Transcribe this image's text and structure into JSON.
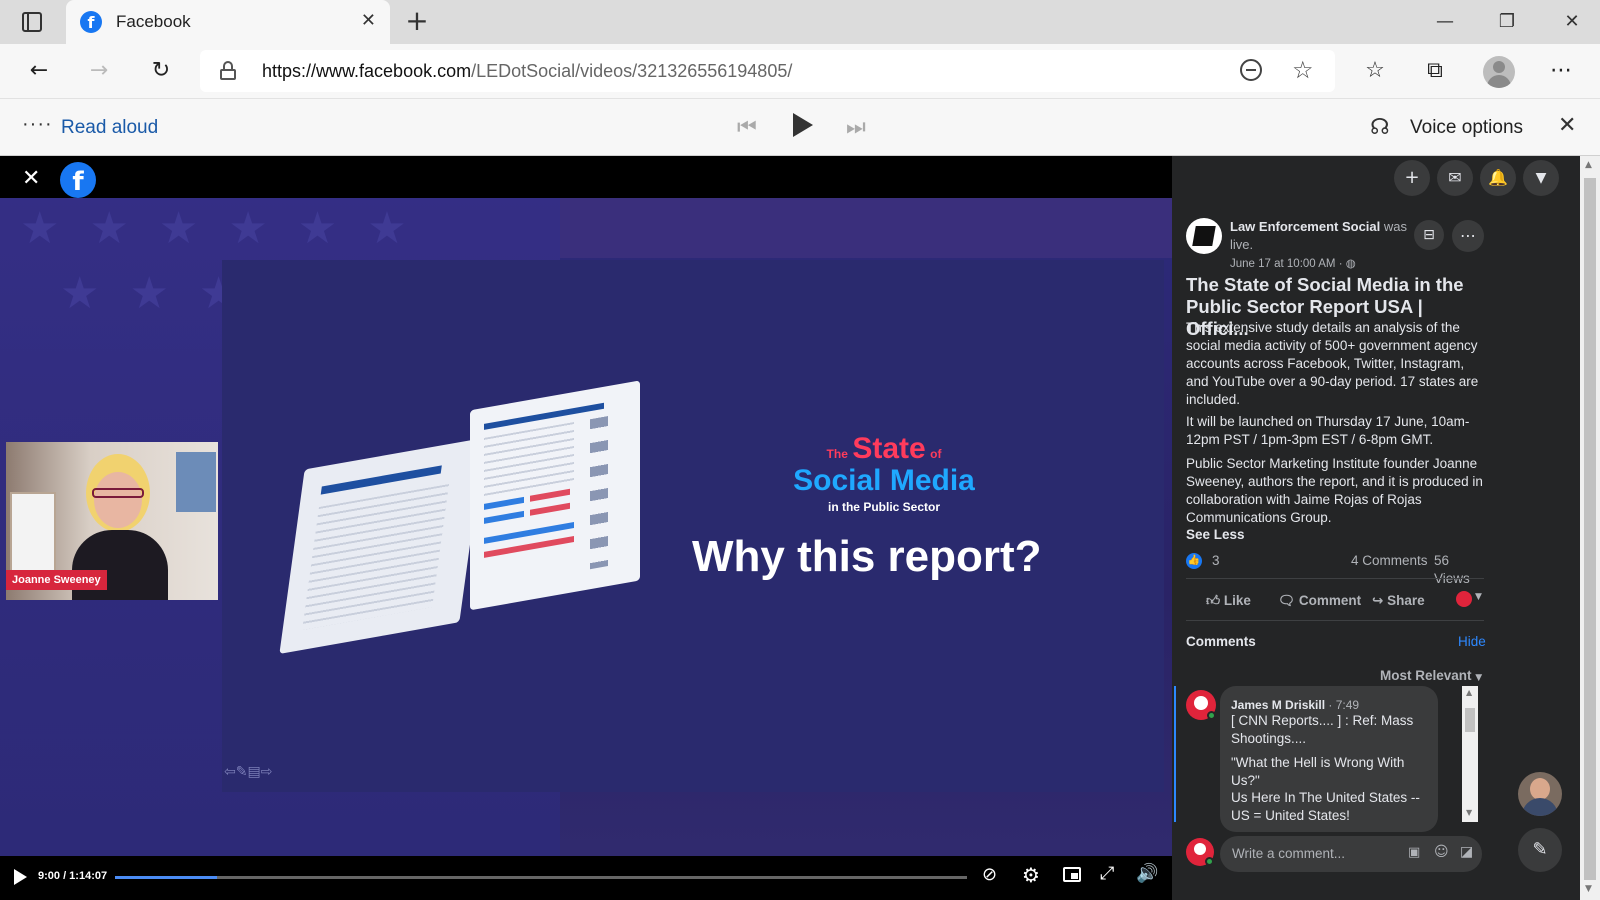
{
  "browser": {
    "tab_title": "Facebook",
    "url_prefix": "https://www.facebook.com",
    "url_path": "/LEDotSocial/videos/321326556194805/"
  },
  "read_aloud": {
    "label": "Read aloud",
    "voice_options": "Voice options"
  },
  "video": {
    "speaker_name": "Joanne Sweeney",
    "slide_brand_the": "The",
    "slide_brand_state": "State",
    "slide_brand_of": "of",
    "slide_brand_social": "Social Media",
    "slide_brand_sub": "in the Public Sector",
    "slide_heading": "Why this report?",
    "time": "9:00 / 1:14:07",
    "progress": 0.12
  },
  "post": {
    "author": "Law Enforcement Social",
    "was_live": "was live.",
    "date": "June 17 at 10:00 AM · ",
    "title": "The State of Social Media in the Public Sector Report USA | Offici...",
    "para1": "This extensive study details an analysis of the social media activity of 500+ government agency accounts across Facebook, Twitter, Instagram, and YouTube over a 90-day period. 17 states are included.",
    "para2": "It will be launched on Thursday 17 June, 10am-12pm PST / 1pm-3pm EST / 6-8pm GMT.",
    "para3": "Public Sector Marketing Institute founder Joanne Sweeney, authors the report, and it is produced in collaboration with Jaime Rojas of Rojas Communications Group.",
    "see_less": "See Less",
    "reactions": "3",
    "comments_count": "4 Comments",
    "views": "56 Views",
    "like": "Like",
    "comment": "Comment",
    "share": "Share"
  },
  "comments": {
    "heading": "Comments",
    "hide": "Hide",
    "sort": "Most Relevant",
    "items": [
      {
        "author": "James M Driskill",
        "time": "7:49",
        "line1": "[ CNN Reports.... ] : Ref: Mass Shootings....",
        "line2": "\"What the Hell is Wrong With Us?\"",
        "line3": "Us Here In The United States -- US = United States!"
      }
    ],
    "write_placeholder": "Write a comment..."
  },
  "colors": {
    "fb_blue": "#1877f2",
    "panel_bg": "#242526",
    "slide_bg": "#2a2a6e",
    "brand_red": "#ff3b5c",
    "brand_cyan": "#1fa8ff"
  }
}
